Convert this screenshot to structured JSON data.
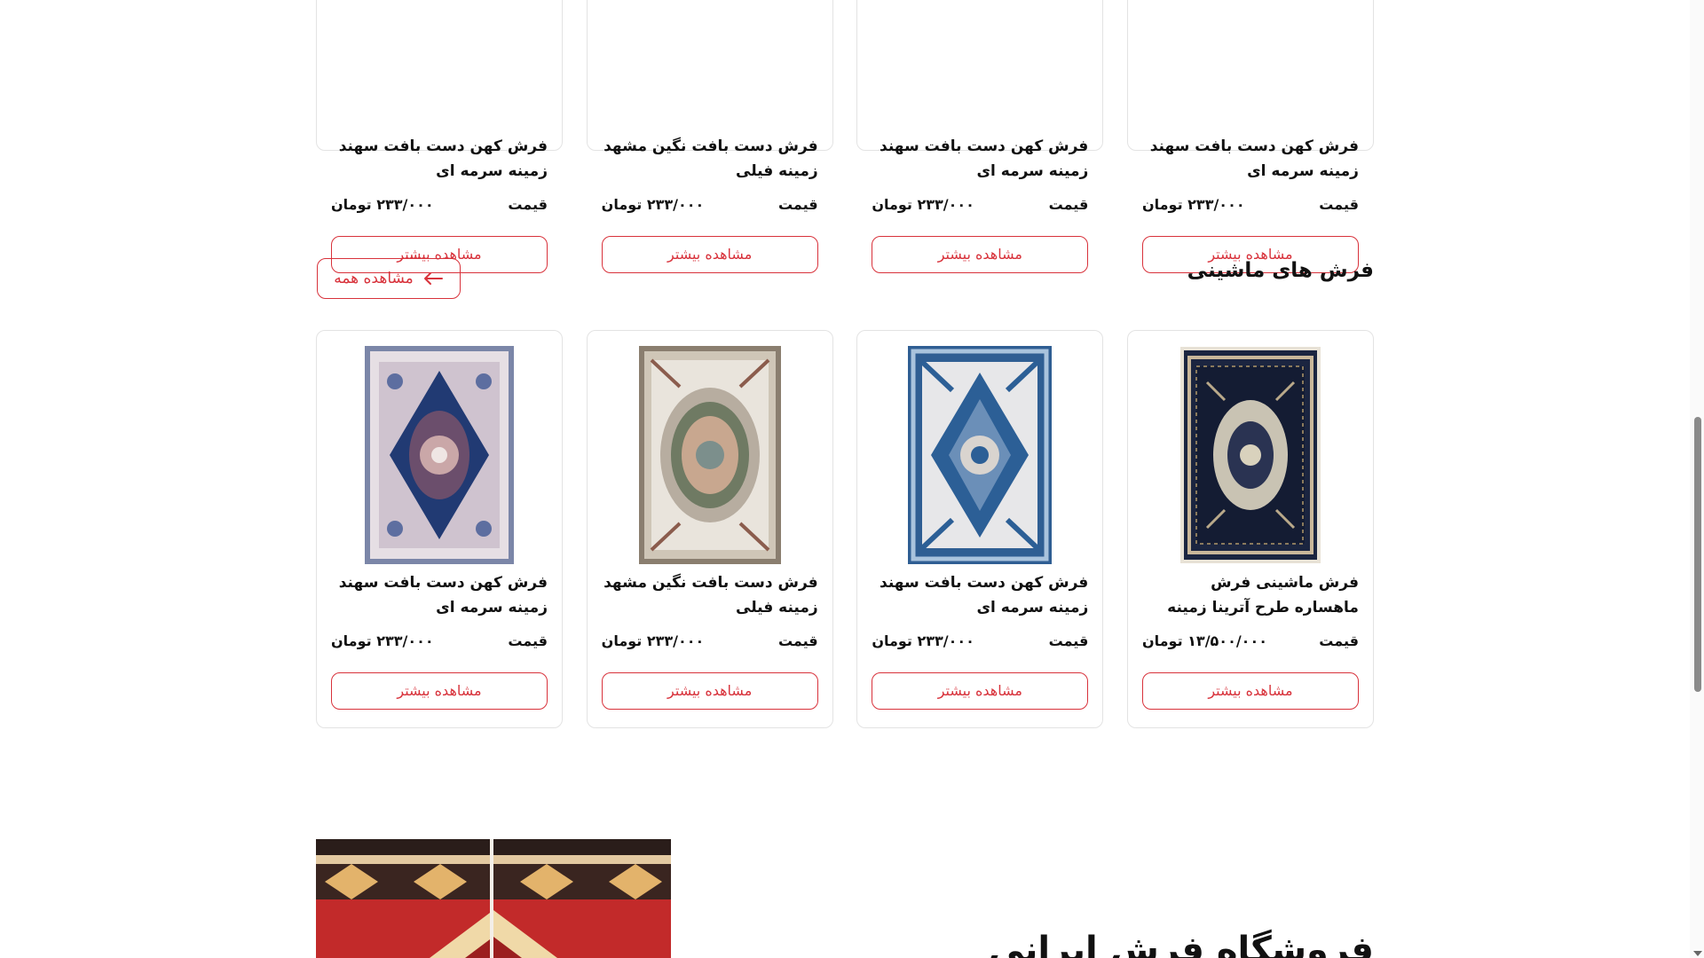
{
  "colors": {
    "accent": "#d8323b",
    "text": "#111111",
    "border": "#e3e3e3"
  },
  "top_row": [
    {
      "title": "فرش کهن دست بافت سهند زمینه سرمه ای",
      "price_label": "قیمت",
      "price": "۲۳۳/۰۰۰ تومان",
      "button": "مشاهده بیشتر"
    },
    {
      "title": "فرش کهن دست بافت سهند زمینه سرمه ای",
      "price_label": "قیمت",
      "price": "۲۳۳/۰۰۰ تومان",
      "button": "مشاهده بیشتر"
    },
    {
      "title": "فرش دست بافت نگین مشهد زمینه فیلی",
      "price_label": "قیمت",
      "price": "۲۳۳/۰۰۰ تومان",
      "button": "مشاهده بیشتر"
    },
    {
      "title": "فرش کهن دست بافت سهند زمینه سرمه ای",
      "price_label": "قیمت",
      "price": "۲۳۳/۰۰۰ تومان",
      "button": "مشاهده بیشتر"
    }
  ],
  "machine_section": {
    "title": "فرش های ماشینی",
    "see_all": "مشاهده همه",
    "products": [
      {
        "title": "فرش ماشینی فرش ماهساره طرح آترینا زمینه آبی",
        "price_label": "قیمت",
        "price": "۱۳/۵۰۰/۰۰۰ تومان",
        "button": "مشاهده بیشتر",
        "image": "navy-rug"
      },
      {
        "title": "فرش کهن دست بافت سهند زمینه سرمه ای",
        "price_label": "قیمت",
        "price": "۲۳۳/۰۰۰ تومان",
        "button": "مشاهده بیشتر",
        "image": "blue-rug"
      },
      {
        "title": "فرش دست بافت نگین مشهد زمینه فیلی",
        "price_label": "قیمت",
        "price": "۲۳۳/۰۰۰ تومان",
        "button": "مشاهده بیشتر",
        "image": "cream-rug"
      },
      {
        "title": "فرش کهن دست بافت سهند زمینه سرمه ای",
        "price_label": "قیمت",
        "price": "۲۳۳/۰۰۰ تومان",
        "button": "مشاهده بیشتر",
        "image": "ivory-rug"
      }
    ]
  },
  "banner": {
    "heading": "فروشگاه فرش ایرانی"
  }
}
